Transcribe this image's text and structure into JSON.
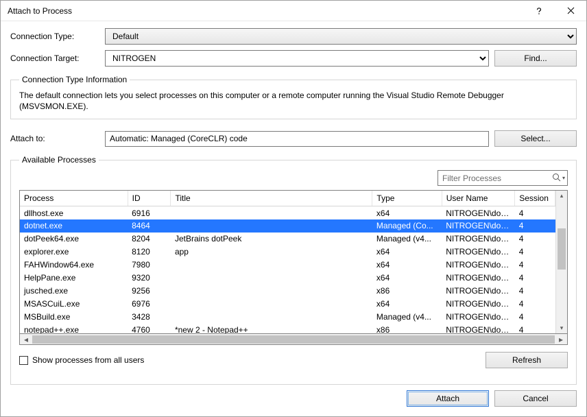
{
  "window": {
    "title": "Attach to Process"
  },
  "form": {
    "connection_type_label": "Connection Type:",
    "connection_type_value": "Default",
    "connection_target_label": "Connection Target:",
    "connection_target_value": "NITROGEN",
    "find_button": "Find...",
    "info_legend": "Connection Type Information",
    "info_text": "The default connection lets you select processes on this computer or a remote computer running the Visual Studio Remote Debugger (MSVSMON.EXE).",
    "attach_to_label": "Attach to:",
    "attach_to_value": "Automatic: Managed (CoreCLR) code",
    "select_button": "Select..."
  },
  "available": {
    "legend": "Available Processes",
    "filter_placeholder": "Filter Processes",
    "columns": {
      "process": "Process",
      "id": "ID",
      "title": "Title",
      "type": "Type",
      "user": "User Name",
      "session": "Session"
    },
    "rows": [
      {
        "process": "dllhost.exe",
        "id": "6916",
        "title": "",
        "type": "x64",
        "user": "NITROGEN\\dominiq...",
        "session": "4",
        "selected": false
      },
      {
        "process": "dotnet.exe",
        "id": "8464",
        "title": "",
        "type": "Managed (Co...",
        "user": "NITROGEN\\dominiq...",
        "session": "4",
        "selected": true
      },
      {
        "process": "dotPeek64.exe",
        "id": "8204",
        "title": "JetBrains dotPeek",
        "type": "Managed (v4...",
        "user": "NITROGEN\\dominiq...",
        "session": "4",
        "selected": false
      },
      {
        "process": "explorer.exe",
        "id": "8120",
        "title": "app",
        "type": "x64",
        "user": "NITROGEN\\dominiq...",
        "session": "4",
        "selected": false
      },
      {
        "process": "FAHWindow64.exe",
        "id": "7980",
        "title": "",
        "type": "x64",
        "user": "NITROGEN\\dominiq...",
        "session": "4",
        "selected": false
      },
      {
        "process": "HelpPane.exe",
        "id": "9320",
        "title": "",
        "type": "x64",
        "user": "NITROGEN\\dominiq...",
        "session": "4",
        "selected": false
      },
      {
        "process": "jusched.exe",
        "id": "9256",
        "title": "",
        "type": "x86",
        "user": "NITROGEN\\dominiq...",
        "session": "4",
        "selected": false
      },
      {
        "process": "MSASCuiL.exe",
        "id": "6976",
        "title": "",
        "type": "x64",
        "user": "NITROGEN\\dominiq...",
        "session": "4",
        "selected": false
      },
      {
        "process": "MSBuild.exe",
        "id": "3428",
        "title": "",
        "type": "Managed (v4...",
        "user": "NITROGEN\\dominiq...",
        "session": "4",
        "selected": false
      },
      {
        "process": "notepad++.exe",
        "id": "4760",
        "title": "*new 2 - Notepad++",
        "type": "x86",
        "user": "NITROGEN\\dominiq...",
        "session": "4",
        "selected": false
      }
    ],
    "show_all_label": "Show processes from all users",
    "refresh_button": "Refresh"
  },
  "footer": {
    "attach_button": "Attach",
    "cancel_button": "Cancel"
  }
}
